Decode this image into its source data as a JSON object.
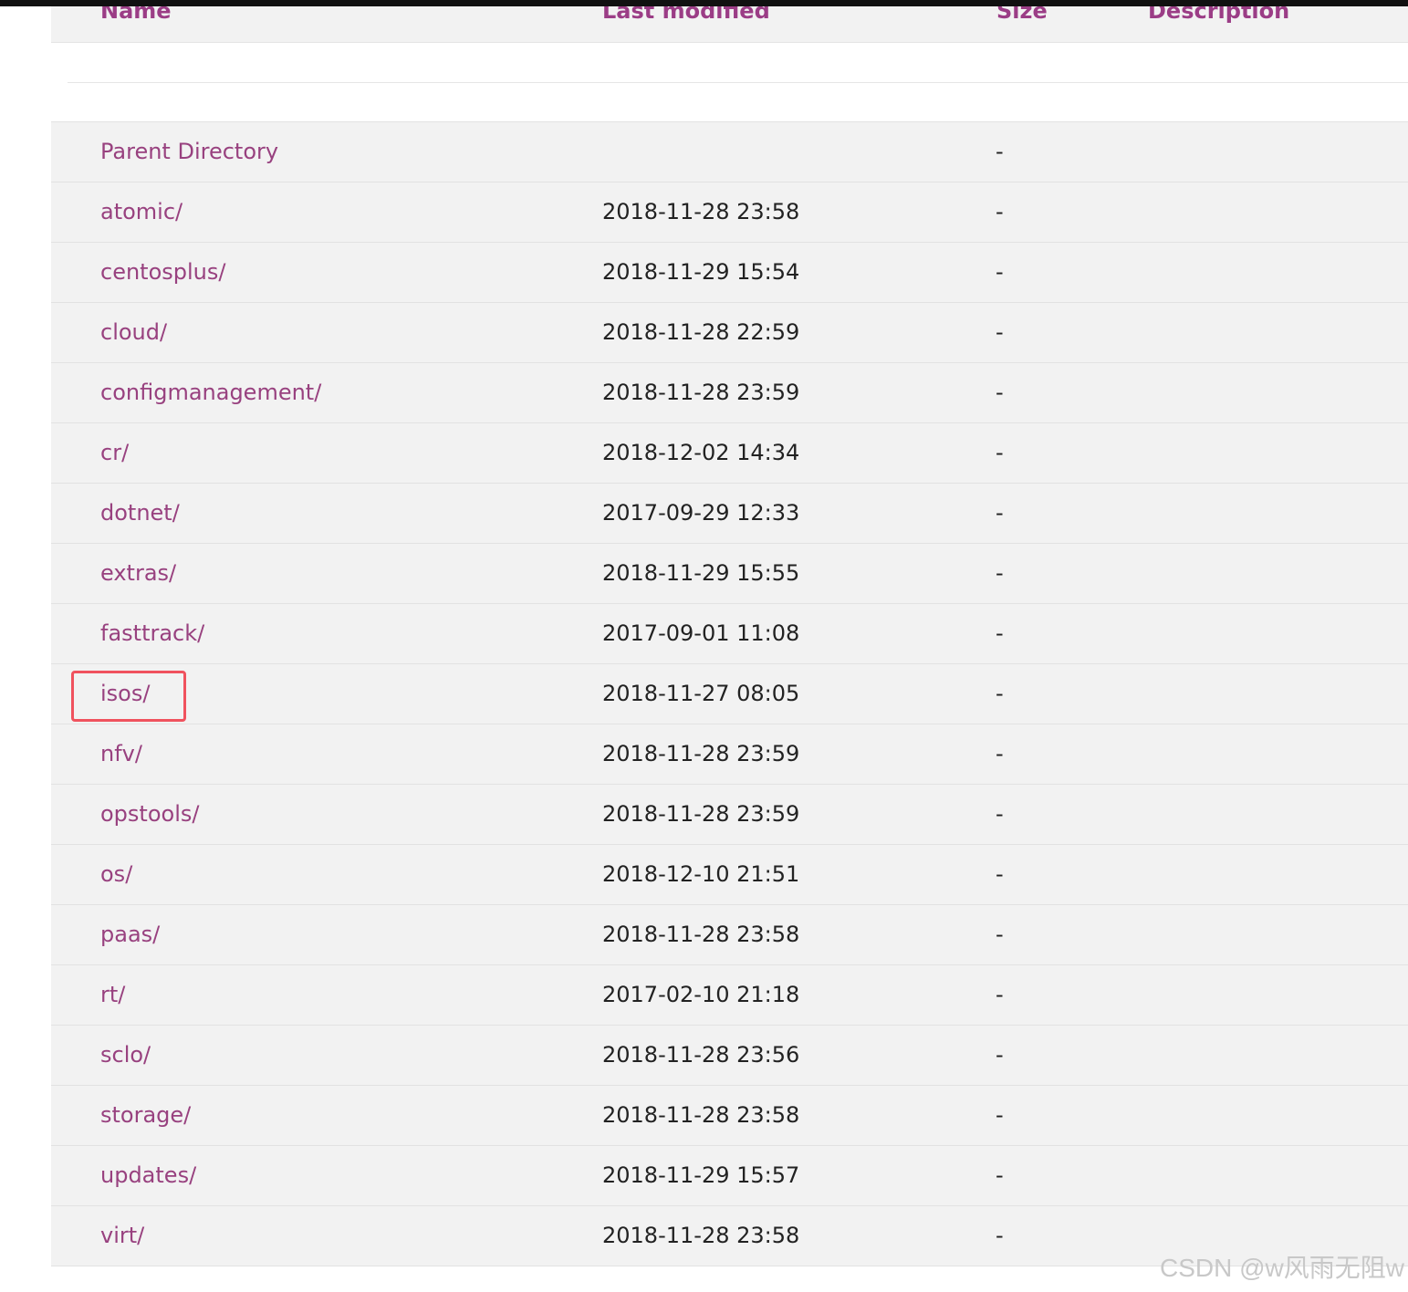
{
  "header": {
    "name": "Name",
    "last_modified": "Last modified",
    "size": "Size",
    "description": "Description"
  },
  "rows": [
    {
      "name": "Parent Directory",
      "modified": "",
      "size": "-",
      "description": ""
    },
    {
      "name": "atomic/",
      "modified": "2018-11-28 23:58",
      "size": "-",
      "description": ""
    },
    {
      "name": "centosplus/",
      "modified": "2018-11-29 15:54",
      "size": "-",
      "description": ""
    },
    {
      "name": "cloud/",
      "modified": "2018-11-28 22:59",
      "size": "-",
      "description": ""
    },
    {
      "name": "configmanagement/",
      "modified": "2018-11-28 23:59",
      "size": "-",
      "description": ""
    },
    {
      "name": "cr/",
      "modified": "2018-12-02 14:34",
      "size": "-",
      "description": ""
    },
    {
      "name": "dotnet/",
      "modified": "2017-09-29 12:33",
      "size": "-",
      "description": ""
    },
    {
      "name": "extras/",
      "modified": "2018-11-29 15:55",
      "size": "-",
      "description": ""
    },
    {
      "name": "fasttrack/",
      "modified": "2017-09-01 11:08",
      "size": "-",
      "description": ""
    },
    {
      "name": "isos/",
      "modified": "2018-11-27 08:05",
      "size": "-",
      "description": ""
    },
    {
      "name": "nfv/",
      "modified": "2018-11-28 23:59",
      "size": "-",
      "description": ""
    },
    {
      "name": "opstools/",
      "modified": "2018-11-28 23:59",
      "size": "-",
      "description": ""
    },
    {
      "name": "os/",
      "modified": "2018-12-10 21:51",
      "size": "-",
      "description": ""
    },
    {
      "name": "paas/",
      "modified": "2018-11-28 23:58",
      "size": "-",
      "description": ""
    },
    {
      "name": "rt/",
      "modified": "2017-02-10 21:18",
      "size": "-",
      "description": ""
    },
    {
      "name": "sclo/",
      "modified": "2018-11-28 23:56",
      "size": "-",
      "description": ""
    },
    {
      "name": "storage/",
      "modified": "2018-11-28 23:58",
      "size": "-",
      "description": ""
    },
    {
      "name": "updates/",
      "modified": "2018-11-29 15:57",
      "size": "-",
      "description": ""
    },
    {
      "name": "virt/",
      "modified": "2018-11-28 23:58",
      "size": "-",
      "description": ""
    }
  ],
  "watermark": "CSDN @w风雨无阻w",
  "colors": {
    "link": "#98417f",
    "header": "#9b3d86",
    "row_bg": "#f2f2f2",
    "highlight": "#f0525e"
  }
}
